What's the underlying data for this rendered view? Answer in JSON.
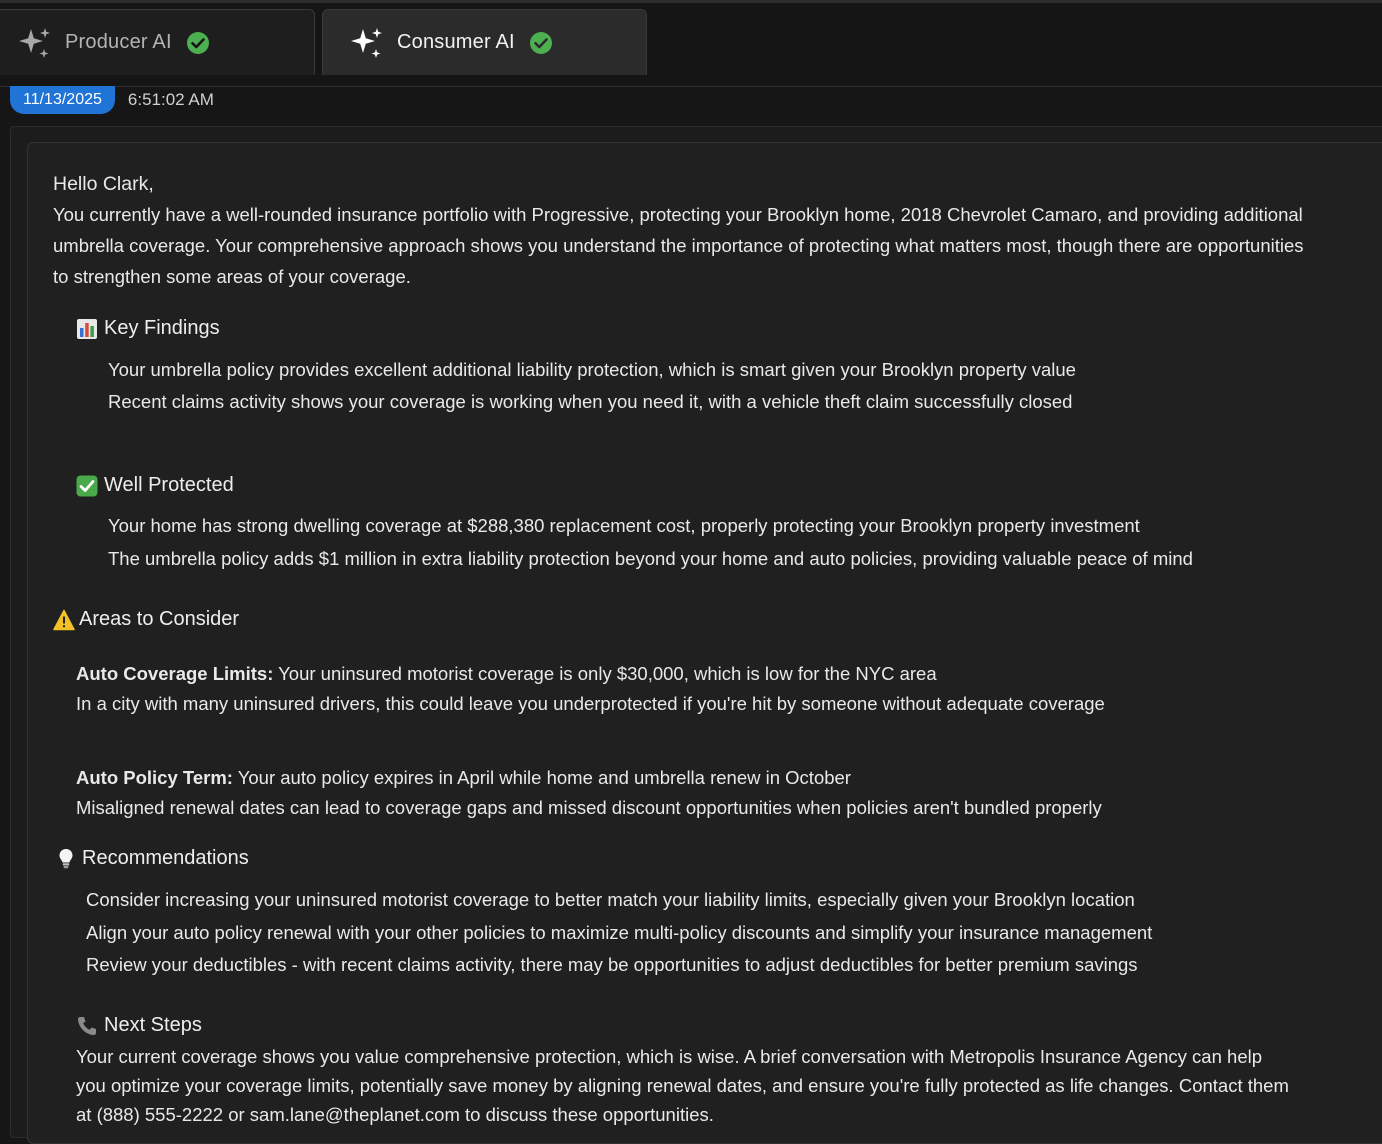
{
  "tabs": [
    {
      "label": "Producer AI",
      "icon": "sparkle-icon",
      "status_icon": "check-circle-icon"
    },
    {
      "label": "Consumer AI",
      "icon": "sparkle-icon",
      "status_icon": "check-circle-icon"
    }
  ],
  "colors": {
    "accent": "#1f74d6",
    "check": "#4caf50",
    "background": "#161616",
    "card": "#202020"
  },
  "timestamp": {
    "date": "11/13/2025",
    "time": "6:51:02 AM"
  },
  "message": {
    "greeting": "Hello Clark,",
    "intro_lines": [
      "You currently have a well-rounded insurance portfolio with Progressive, protecting your Brooklyn home, 2018 Chevrolet Camaro, and providing additional",
      "umbrella coverage. Your comprehensive approach shows you understand the importance of protecting what matters most, though there are opportunities",
      "to strengthen some areas of your coverage."
    ],
    "key_findings": {
      "title": "Key Findings",
      "icon": "bar-chart-icon",
      "items": [
        "Your umbrella policy provides excellent additional liability protection, which is smart given your Brooklyn property value",
        "Recent claims activity shows your coverage is working when you need it, with a vehicle theft claim successfully closed"
      ]
    },
    "well_protected": {
      "title": "Well Protected",
      "icon": "check-box-icon",
      "items": [
        "Your home has strong dwelling coverage at $288,380 replacement cost, properly protecting your Brooklyn property investment",
        "The umbrella policy adds $1 million in extra liability protection beyond your home and auto policies, providing valuable peace of mind"
      ]
    },
    "areas": {
      "title": "Areas to Consider",
      "icon": "warning-icon",
      "items": [
        {
          "label": "Auto Coverage Limits:",
          "text": " Your uninsured motorist coverage is only $30,000, which is low for the NYC area",
          "detail": "In a city with many uninsured drivers, this could leave you underprotected if you're hit by someone without adequate coverage"
        },
        {
          "label": "Auto Policy Term:",
          "text": " Your auto policy expires in April while home and umbrella renew in October",
          "detail": "Misaligned renewal dates can lead to coverage gaps and missed discount opportunities when policies aren't bundled properly"
        }
      ]
    },
    "recommendations": {
      "title": "Recommendations",
      "icon": "lightbulb-icon",
      "items": [
        "Consider increasing your uninsured motorist coverage to better match your liability limits, especially given your Brooklyn location",
        "Align your auto policy renewal with your other policies to maximize multi-policy discounts and simplify your insurance management",
        "Review your deductibles - with recent claims activity, there may be opportunities to adjust deductibles for better premium savings"
      ]
    },
    "next_steps": {
      "title": "Next Steps",
      "icon": "phone-icon",
      "lines": [
        "Your current coverage shows you value comprehensive protection, which is wise. A brief conversation with Metropolis Insurance Agency can help",
        "you optimize your coverage limits, potentially save money by aligning renewal dates, and ensure you're fully protected as life changes. Contact them",
        "at (888) 555-2222 or sam.lane@theplanet.com to discuss these opportunities."
      ]
    }
  }
}
